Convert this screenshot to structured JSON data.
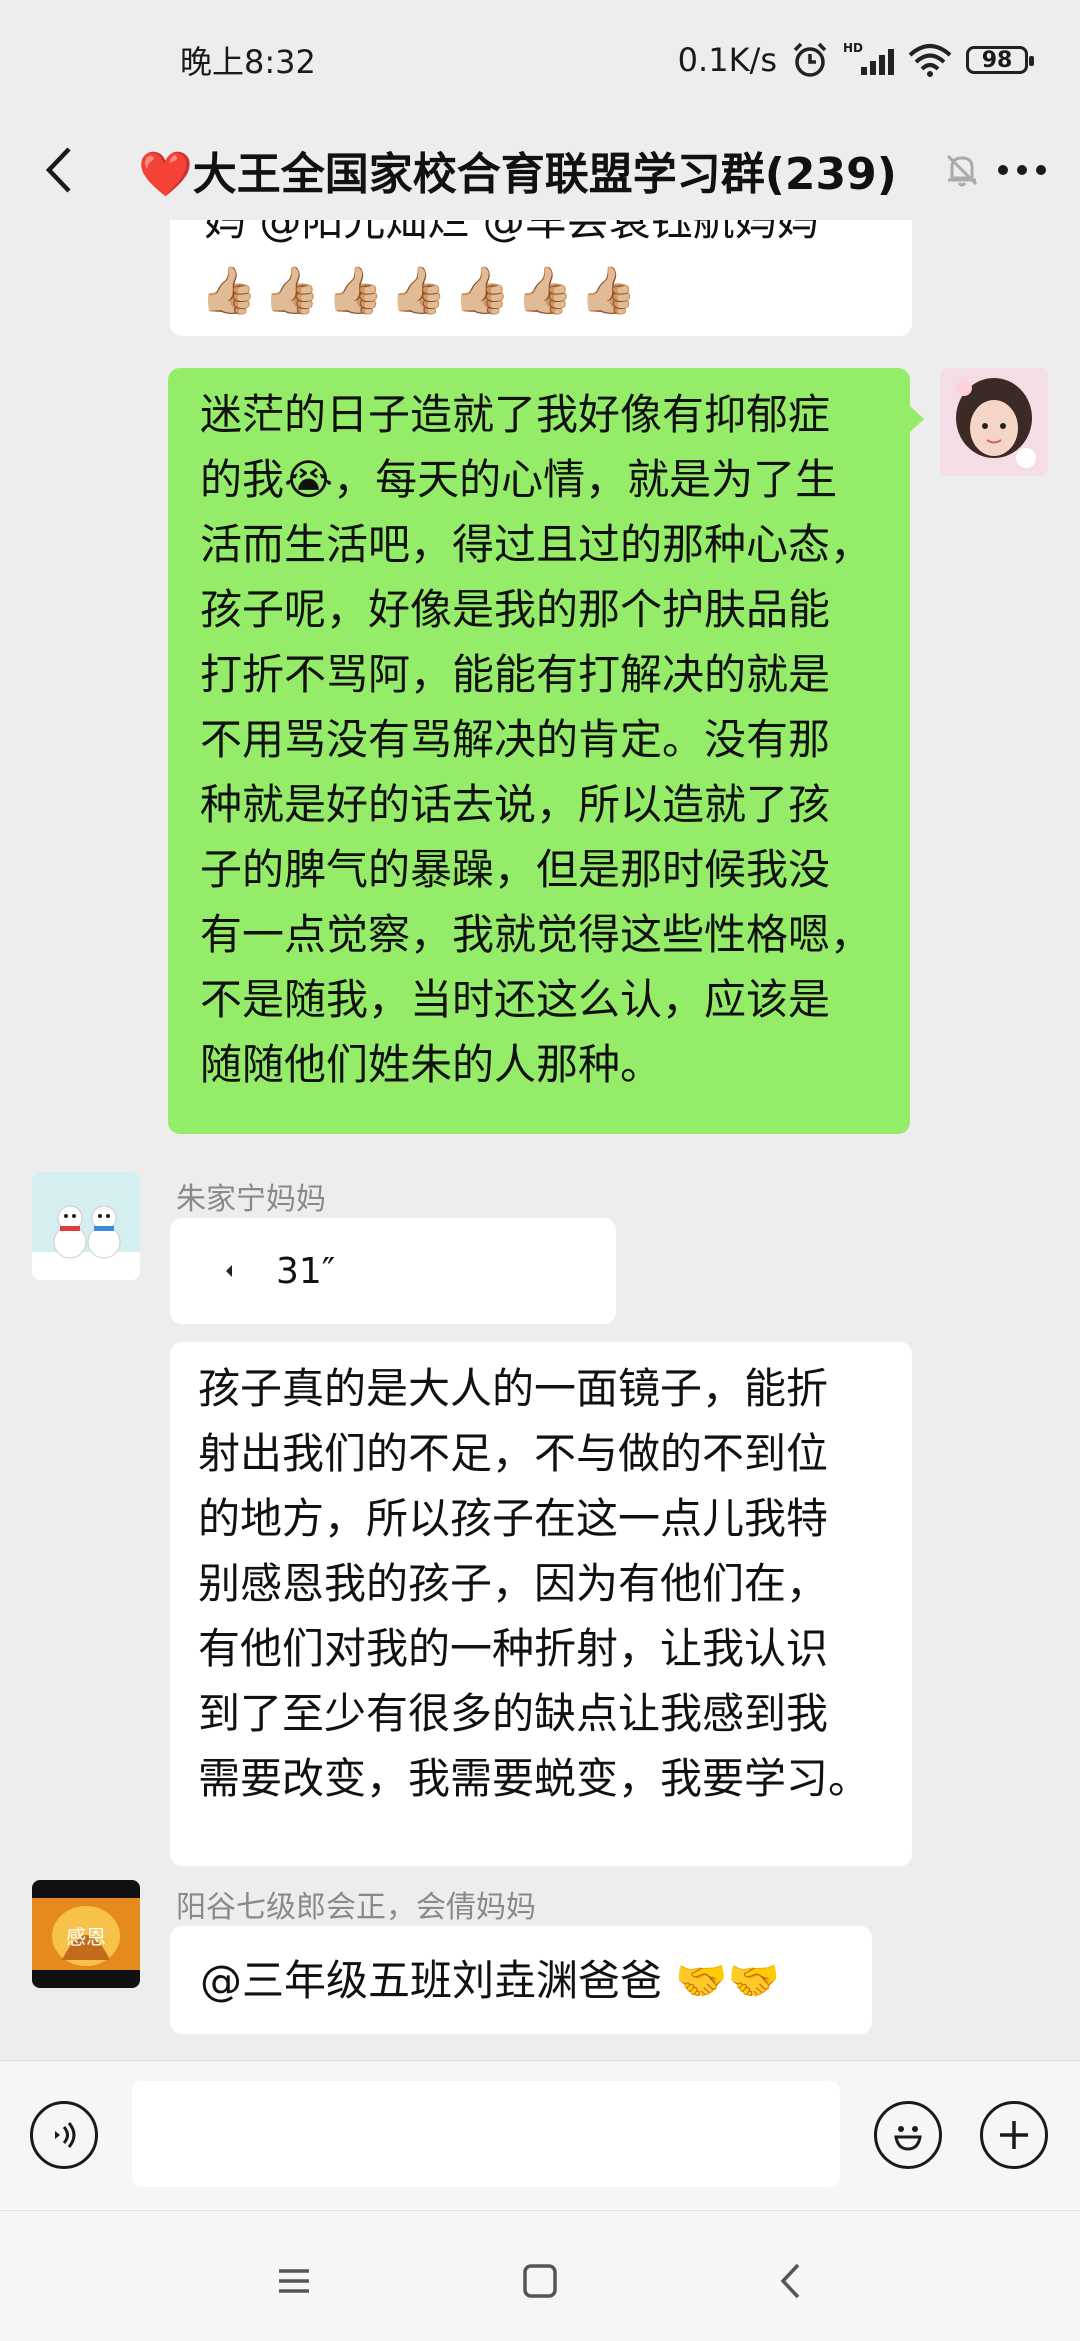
{
  "status_bar": {
    "time": "晚上8:32",
    "net_speed": "0.1K/s",
    "network_label": "HD",
    "battery": "98"
  },
  "header": {
    "title": "❤️大王全国家校合育联盟学习群(239)"
  },
  "messages": [
    {
      "type": "text",
      "side": "left",
      "partial_line": "妈 @阳光灿烂 @车尝袁钰航妈妈",
      "text": "👍🏼👍🏼👍🏼👍🏼👍🏼👍🏼👍🏼"
    },
    {
      "type": "text",
      "side": "right",
      "lines": [
        "迷茫的日子造就了我好像有抑郁症",
        "的我😭，每天的心情，就是为了生",
        "活而生活吧，得过且过的那种心态，",
        "孩子呢，好像是我的那个护肤品能",
        "打折不骂阿，能能有打解决的就是",
        "不用骂没有骂解决的肯定。没有那",
        "种就是好的话去说，所以造就了孩",
        "子的脾气的暴躁，但是那时候我没",
        "有一点觉察，我就觉得这些性格嗯，",
        "不是随我，当时还这么认，应该是",
        "随随他们姓朱的人那种。"
      ]
    },
    {
      "type": "voice",
      "side": "left",
      "sender": "朱家宁妈妈",
      "duration": "31″"
    },
    {
      "type": "text",
      "side": "left",
      "lines": [
        "孩子真的是大人的一面镜子，能折",
        "射出我们的不足，不与做的不到位",
        "的地方，所以孩子在这一点儿我特",
        "别感恩我的孩子，因为有他们在，",
        "有他们对我的一种折射，让我认识",
        "到了至少有很多的缺点让我感到我",
        "需要改变，我需要蜕变，我要学习。"
      ]
    },
    {
      "type": "text",
      "side": "left",
      "sender": "阳谷七级郎会正，会倩妈妈",
      "text": "@三年级五班刘垚渊爸爸 🤝🤝",
      "avatar_text": "感恩"
    }
  ],
  "colors": {
    "background": "#ededed",
    "own_bubble": "#95ec69",
    "other_bubble": "#ffffff"
  }
}
